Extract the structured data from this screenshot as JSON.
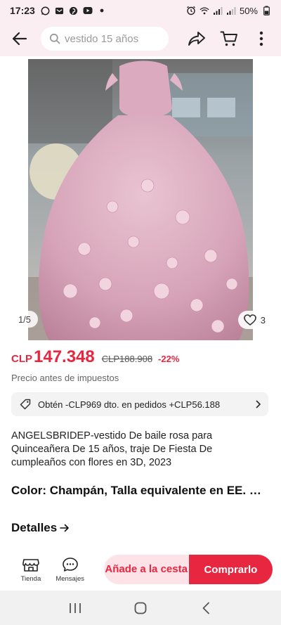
{
  "status_bar": {
    "time": "17:23",
    "battery": "50%",
    "icons_left": [
      "whatsapp-icon",
      "mail-icon",
      "pinterest-icon",
      "youtube-icon",
      "dot-icon"
    ],
    "icons_right": [
      "alarm-icon",
      "wifi-icon",
      "signal-icon",
      "signal-icon",
      "battery-icon"
    ]
  },
  "header": {
    "search_placeholder": "vestido 15 años",
    "icons": [
      "back-arrow-icon",
      "search-icon",
      "share-icon",
      "cart-icon",
      "more-icon"
    ]
  },
  "gallery": {
    "counter": "1/5",
    "wishlist_count": "3"
  },
  "price": {
    "currency": "CLP",
    "amount": "147.348",
    "original": "CLP188.908",
    "discount": "-22%",
    "tax_note": "Precio antes de impuestos"
  },
  "coupon": {
    "text": "Obtén -CLP969 dto. en pedidos +CLP56.188"
  },
  "product": {
    "title": "ANGELSBRIDEP-vestido De baile rosa para Quinceañera De 15 años, traje De Fiesta De cumpleaños con flores en 3D, 2023",
    "variant": "Color: Champán, Talla equivalente en EE. UU.",
    "details_label": "Detalles"
  },
  "bottom_bar": {
    "store_label": "Tienda",
    "messages_label": "Mensajes",
    "add_to_cart": "Añade a la cesta",
    "buy_now": "Comprarlo"
  },
  "colors": {
    "accent": "#e8263f",
    "accent_light": "#fde3e7",
    "header_bg": "#fbeef2"
  }
}
